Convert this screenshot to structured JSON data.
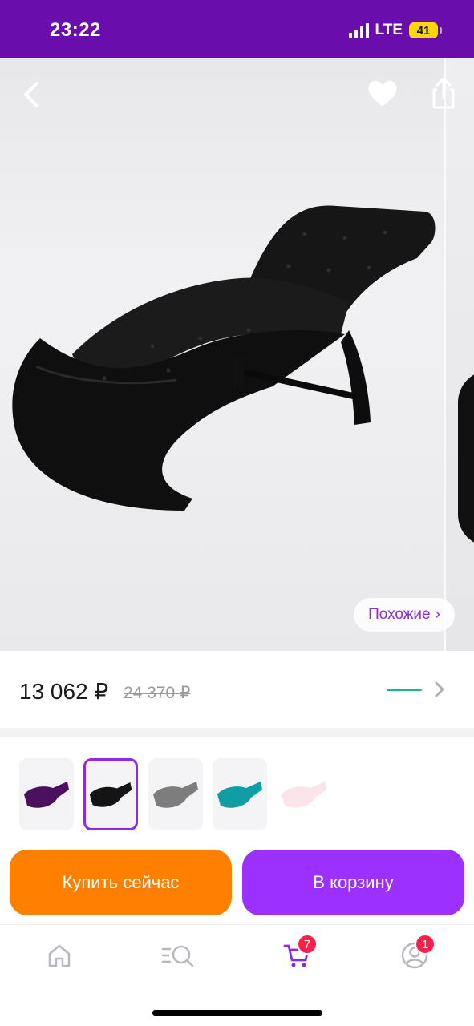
{
  "status_bar": {
    "time": "23:22",
    "network": "LTE",
    "battery": "41",
    "battery_color": "#ffd60a",
    "background": "#6a0dad"
  },
  "product": {
    "image_subject": "black tufted chaise lounge",
    "similar_label": "Похожие",
    "similar_chevron": "›"
  },
  "price": {
    "current": "13 062 ₽",
    "old": "24 370 ₽",
    "indicator_color": "#10b981"
  },
  "variants": [
    {
      "color": "purple",
      "hex": "#4b1060",
      "selected": false
    },
    {
      "color": "black",
      "hex": "#141414",
      "selected": true
    },
    {
      "color": "grey",
      "hex": "#7d7d7d",
      "selected": false
    },
    {
      "color": "teal",
      "hex": "#0e9ea3",
      "selected": false
    },
    {
      "color": "pink",
      "hex": "#f4b6c8",
      "selected": false
    }
  ],
  "actions": {
    "buy_now": "Купить сейчас",
    "add_to_cart": "В корзину",
    "buy_now_color": "#ff7f00",
    "add_to_cart_color": "#9b30ff"
  },
  "tabbar": {
    "items": [
      {
        "icon": "home-icon",
        "badge": ""
      },
      {
        "icon": "catalog-search-icon",
        "badge": ""
      },
      {
        "icon": "cart-icon",
        "badge": "7"
      },
      {
        "icon": "profile-icon",
        "badge": "1"
      }
    ],
    "active_color": "#8b2be2",
    "inactive_color": "#b8b8c0",
    "badge_color": "#ff1f4b"
  }
}
